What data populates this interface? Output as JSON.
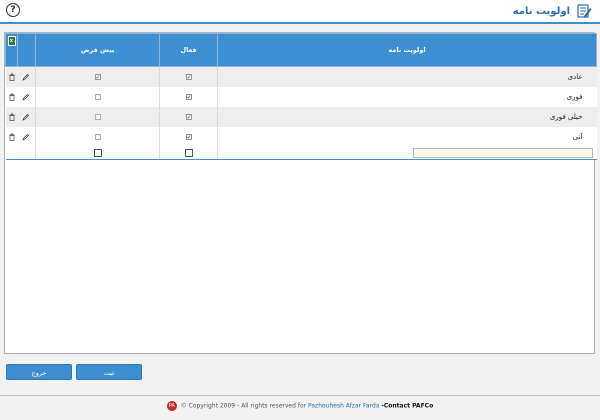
{
  "header": {
    "title": "اولویت نامه",
    "title_icon": "edit-document-icon",
    "help_icon": "question-circle-icon",
    "help_glyph": "?"
  },
  "table": {
    "export_icon": "excel-icon",
    "export_glyph": "x",
    "columns": {
      "default": "پیش فرض",
      "active": "فعال",
      "priority": "اولویت نامه"
    },
    "rows": [
      {
        "name": "عادی",
        "active": true,
        "default": true
      },
      {
        "name": "فوری",
        "active": true,
        "default": false
      },
      {
        "name": "خیلی فوری",
        "active": true,
        "default": false
      },
      {
        "name": "آنی",
        "active": true,
        "default": false
      }
    ],
    "new_row": {
      "name_value": "",
      "active": false,
      "default": false
    }
  },
  "buttons": {
    "exit": "خروج",
    "save": "ثبت"
  },
  "footer": {
    "logo_text": "PA",
    "copyright": "© Copyright 2009 - All rights reserved for",
    "company": "Pazhouhesh Afzar Farda",
    "contact": "-Contact PAFCo"
  },
  "colors": {
    "accent": "#3d8fd1",
    "title": "#2a6fb0",
    "input_bg": "#fffbe6"
  }
}
